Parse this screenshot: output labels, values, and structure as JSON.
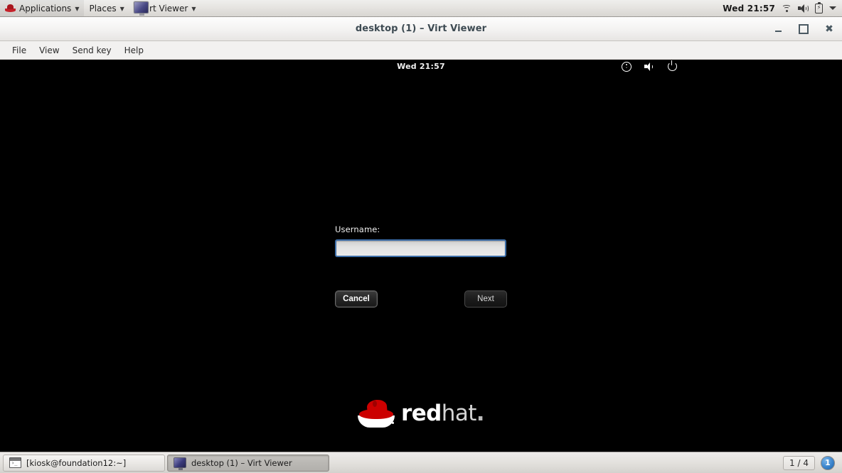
{
  "top_panel": {
    "applications_label": "Applications",
    "places_label": "Places",
    "app_window_label": "Virt Viewer",
    "clock": "Wed 21:57",
    "icons": [
      "redhat-icon",
      "wifi-icon",
      "volume-icon",
      "battery-icon",
      "chevron-down-icon"
    ]
  },
  "window": {
    "title": "desktop (1) – Virt Viewer",
    "controls": {
      "minimize": "–",
      "maximize": "□",
      "close": "✕"
    },
    "menus": [
      "File",
      "View",
      "Send key",
      "Help"
    ]
  },
  "guest": {
    "topbar": {
      "clock": "Wed 21:57",
      "icons": [
        "accessibility-icon",
        "volume-icon",
        "power-icon"
      ]
    },
    "login": {
      "username_label": "Username:",
      "username_value": "",
      "username_placeholder": "",
      "cancel_label": "Cancel",
      "next_label": "Next"
    },
    "branding": {
      "word_red": "red",
      "word_hat": "hat",
      "trademark": "."
    }
  },
  "taskbar": {
    "items": [
      {
        "label": "[kiosk@foundation12:~]",
        "icon": "terminal-icon",
        "active": false
      },
      {
        "label": "desktop (1) – Virt Viewer",
        "icon": "monitor-icon",
        "active": true
      }
    ],
    "workspace_count": "1 / 4",
    "workspace_badge": "1"
  },
  "colors": {
    "panel_bg": "#e6e4e1",
    "guest_bg": "#000000",
    "input_border": "#3d6ea8",
    "redhat_red": "#cc0000",
    "badge_blue": "#3a84cc"
  }
}
